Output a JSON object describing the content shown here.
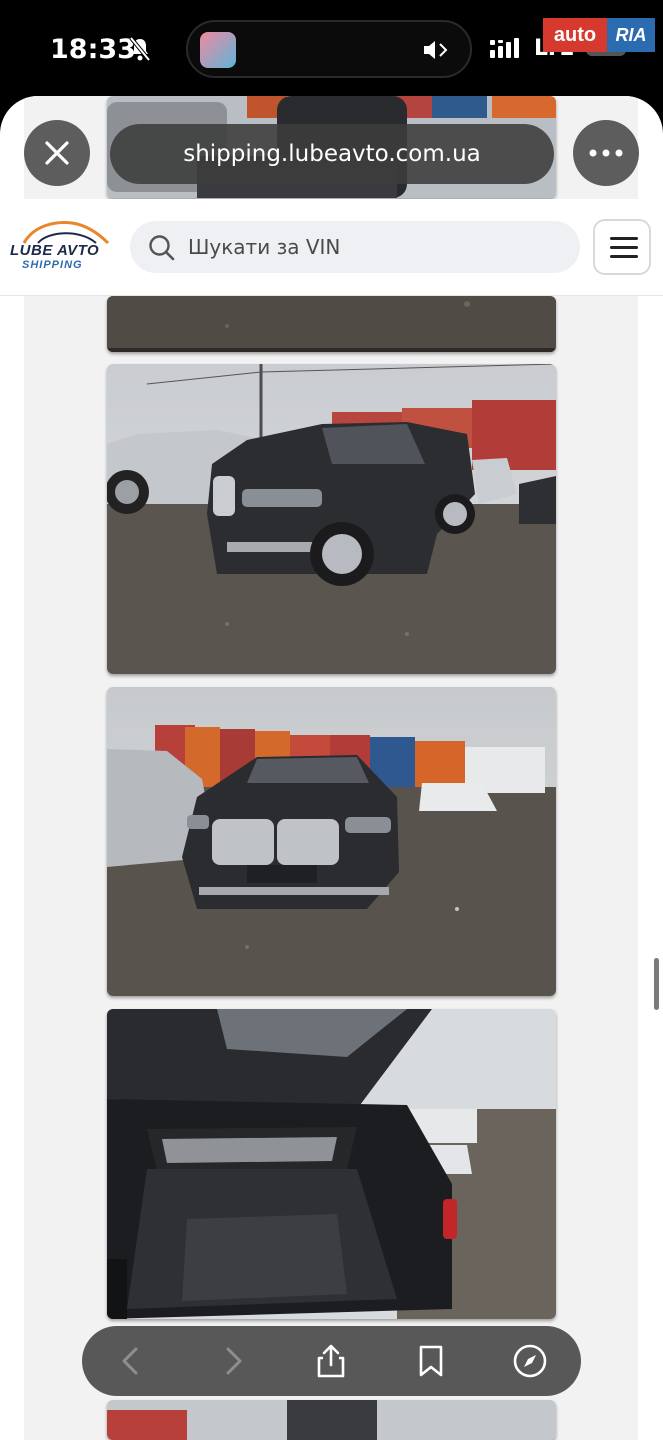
{
  "status_bar": {
    "time": "18:33",
    "network": "LTE",
    "icons": [
      "bell-slash-icon",
      "audio-icon",
      "signal-icon",
      "battery-icon"
    ]
  },
  "watermark": {
    "auto": "auto",
    "ria": "RIA"
  },
  "browser": {
    "url": "shipping.lubeavto.com.ua",
    "close_icon": "close-icon",
    "more_icon": "more-icon"
  },
  "site": {
    "logo_text": "LUBE AVTO",
    "logo_sub": "SHIPPING",
    "search_placeholder": "Шукати за VIN",
    "menu_icon": "hamburger-menu-icon"
  },
  "gallery": {
    "photos": [
      "bmw-x5-top-cropped",
      "bmw-x5-front-three-quarter",
      "bmw-x5-front",
      "bmw-x5-trunk-open"
    ]
  },
  "toolbar": {
    "buttons": [
      "back-icon",
      "forward-icon",
      "share-icon",
      "bookmarks-icon",
      "compass-icon"
    ]
  },
  "colors": {
    "accent_blue": "#2b6cb0",
    "brand_orange": "#e8862a",
    "auto_red": "#d63a2f"
  }
}
